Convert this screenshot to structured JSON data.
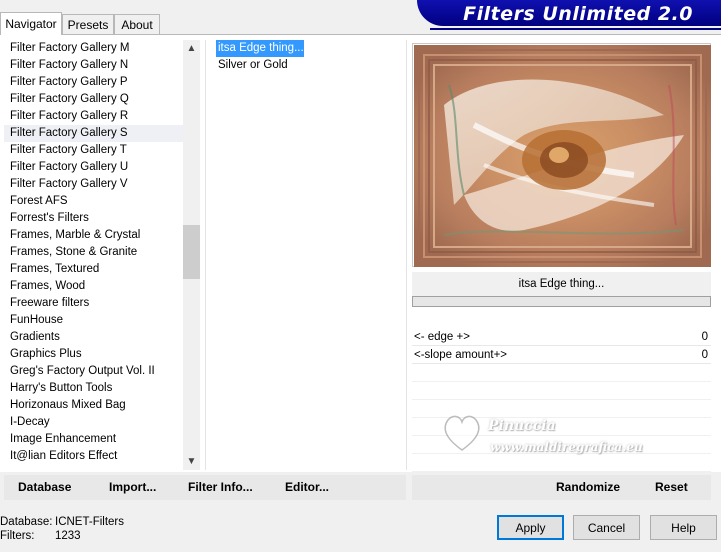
{
  "tabs": [
    {
      "label": "Navigator",
      "active": true
    },
    {
      "label": "Presets",
      "active": false
    },
    {
      "label": "About",
      "active": false
    }
  ],
  "title": "Filters Unlimited 2.0",
  "categories": [
    "Filter Factory Gallery M",
    "Filter Factory Gallery N",
    "Filter Factory Gallery P",
    "Filter Factory Gallery Q",
    "Filter Factory Gallery R",
    "Filter Factory Gallery S",
    "Filter Factory Gallery T",
    "Filter Factory Gallery U",
    "Filter Factory Gallery V",
    "Forest AFS",
    "Forrest's Filters",
    "Frames, Marble & Crystal",
    "Frames, Stone & Granite",
    "Frames, Textured",
    "Frames, Wood",
    "Freeware filters",
    "FunHouse",
    "Gradients",
    "Graphics Plus",
    "Greg's Factory Output Vol. II",
    "Harry's Button Tools",
    "Horizonaus Mixed Bag",
    "I-Decay",
    "Image Enhancement",
    "It@lian Editors Effect"
  ],
  "selected_category": "Filter Factory Gallery S",
  "filters": [
    "itsa Edge thing...",
    "Silver or Gold"
  ],
  "selected_filter": "itsa Edge thing...",
  "current_filter_name": "itsa Edge thing...",
  "params": [
    {
      "label": "<- edge +>",
      "value": "0"
    },
    {
      "label": "<-slope amount+>",
      "value": "0"
    }
  ],
  "watermark": {
    "name": "Pinuccia",
    "site": "www.maldiregrafica.eu"
  },
  "left_buttons": [
    "Database",
    "Import...",
    "Filter Info...",
    "Editor..."
  ],
  "right_buttons": [
    "Randomize",
    "Reset"
  ],
  "status": {
    "database_label": "Database:",
    "database_value": "ICNET-Filters",
    "filters_label": "Filters:",
    "filters_value": "1233"
  },
  "dialog_buttons": {
    "apply": "Apply",
    "cancel": "Cancel",
    "help": "Help"
  },
  "colors": {
    "title_bar": "#000080",
    "selection": "#3399ff",
    "default_button_border": "#0078d7"
  }
}
